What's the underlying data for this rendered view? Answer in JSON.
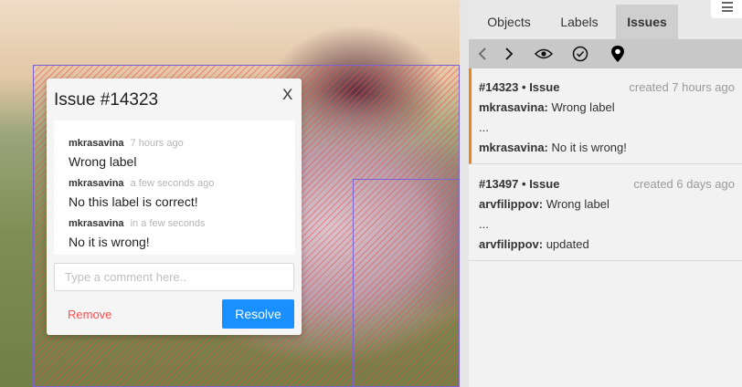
{
  "issue_dialog": {
    "title": "Issue #14323",
    "close_glyph": "X",
    "comments": [
      {
        "author": "mkrasavina",
        "time": "7 hours ago",
        "text": "Wrong label"
      },
      {
        "author": "mkrasavina",
        "time": "a few seconds ago",
        "text": "No this label is correct!"
      },
      {
        "author": "mkrasavina",
        "time": "in a few seconds",
        "text": "No it is wrong!"
      }
    ],
    "comment_placeholder": "Type a comment here..",
    "remove_label": "Remove",
    "resolve_label": "Resolve"
  },
  "sidebar": {
    "tabs": [
      {
        "label": "Objects",
        "active": false
      },
      {
        "label": "Labels",
        "active": false
      },
      {
        "label": "Issues",
        "active": true
      }
    ],
    "toolbar": [
      "prev-icon",
      "next-icon",
      "eye-icon",
      "check-circle-icon",
      "map-pin-icon"
    ],
    "issues": [
      {
        "id": "#14323",
        "type": "Issue",
        "created": "created 7 hours ago",
        "first_author": "mkrasavina:",
        "first_text": "Wrong label",
        "ellipsis": "...",
        "last_author": "mkrasavina:",
        "last_text": "No it is wrong!",
        "selected": true
      },
      {
        "id": "#13497",
        "type": "Issue",
        "created": "created 6 days ago",
        "first_author": "arvfilippov:",
        "first_text": "Wrong label",
        "ellipsis": "...",
        "last_author": "arvfilippov:",
        "last_text": "updated",
        "selected": false
      }
    ]
  },
  "colors": {
    "accent": "#1890ff",
    "danger": "#ff4d4f",
    "selected_border": "#f0821e",
    "annotation_box": "#7b63d6",
    "hatch": "#ff4646"
  }
}
